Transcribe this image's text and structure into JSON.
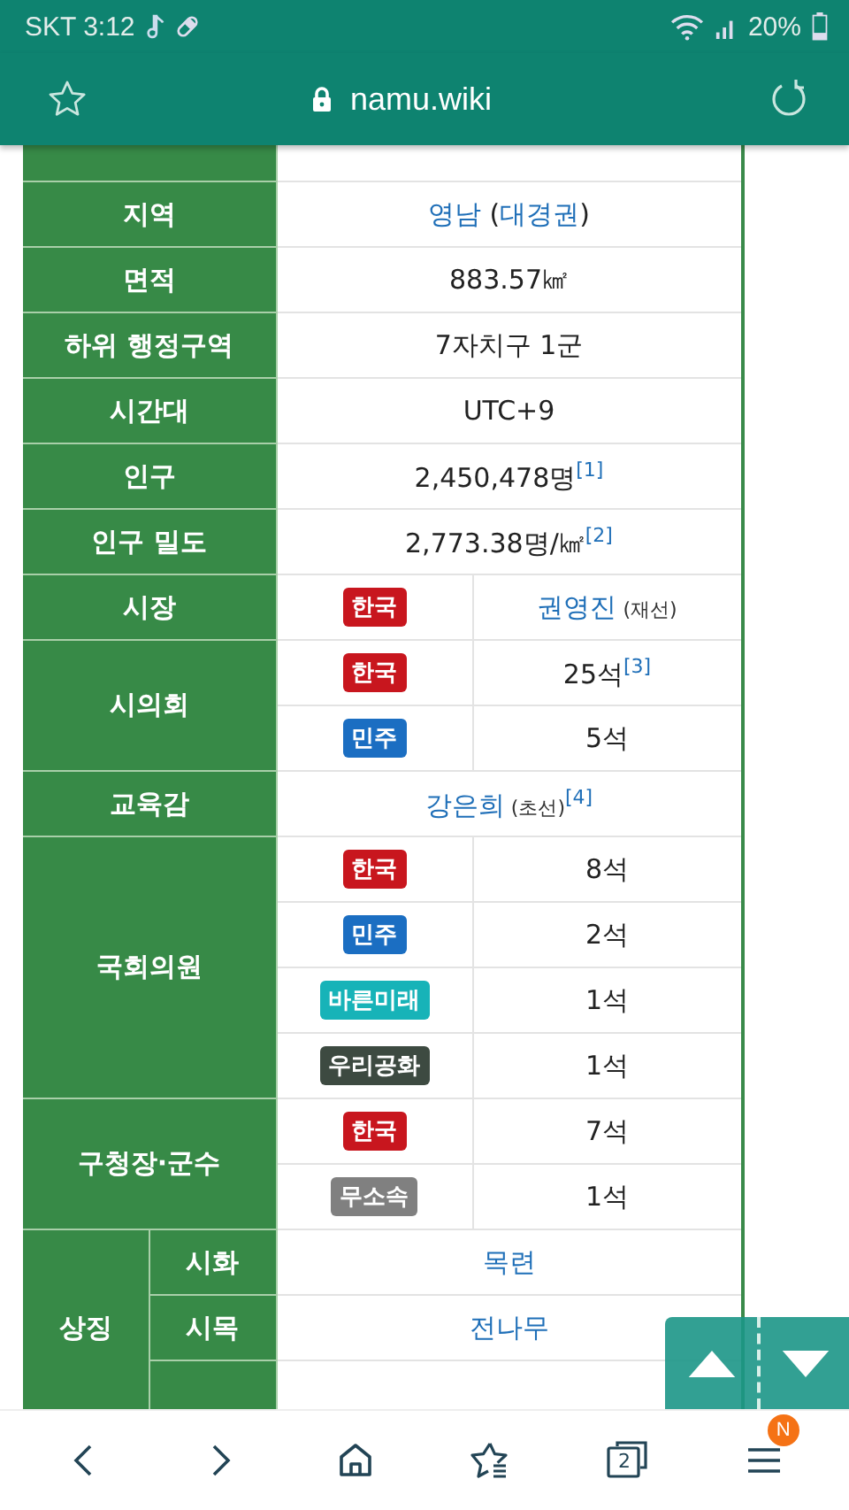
{
  "status_bar": {
    "carrier_time": "SKT 3:12",
    "battery": "20%"
  },
  "address_bar": {
    "url": "namu.wiki"
  },
  "infobox": {
    "rows": [
      {
        "kind": "single",
        "label": "지역",
        "value": [
          {
            "kind": "link",
            "text": "영남"
          },
          {
            "kind": "text",
            "text": " ("
          },
          {
            "kind": "link",
            "text": "대경권"
          },
          {
            "kind": "text",
            "text": ")"
          }
        ]
      },
      {
        "kind": "single",
        "label": "면적",
        "value": [
          {
            "kind": "text",
            "text": "883.57㎢"
          }
        ]
      },
      {
        "kind": "single",
        "label": "하위 행정구역",
        "value": [
          {
            "kind": "text",
            "text": "7자치구 1군"
          }
        ]
      },
      {
        "kind": "single",
        "label": "시간대",
        "value": [
          {
            "kind": "text",
            "text": "UTC+9"
          }
        ]
      },
      {
        "kind": "single",
        "label": "인구",
        "value": [
          {
            "kind": "text",
            "text": "2,450,478명"
          },
          {
            "kind": "note",
            "text": "[1]"
          }
        ]
      },
      {
        "kind": "single",
        "label": "인구 밀도",
        "value": [
          {
            "kind": "text",
            "text": "2,773.38명/㎢"
          },
          {
            "kind": "note",
            "text": "[2]"
          }
        ]
      },
      {
        "kind": "party",
        "label": "시장",
        "entries": [
          {
            "party": "한국",
            "color": "#c8161e",
            "value": [
              {
                "kind": "link",
                "text": "권영진"
              },
              {
                "kind": "small",
                "text": " (재선)"
              }
            ]
          }
        ]
      },
      {
        "kind": "party",
        "label": "시의회",
        "entries": [
          {
            "party": "한국",
            "color": "#c8161e",
            "value": [
              {
                "kind": "text",
                "text": "25석"
              },
              {
                "kind": "note",
                "text": "[3]"
              }
            ]
          },
          {
            "party": "민주",
            "color": "#1b6ec2",
            "value": [
              {
                "kind": "text",
                "text": "5석"
              }
            ]
          }
        ]
      },
      {
        "kind": "single",
        "label": "교육감",
        "value": [
          {
            "kind": "link",
            "text": "강은희"
          },
          {
            "kind": "small",
            "text": " (초선)"
          },
          {
            "kind": "note",
            "text": "[4]"
          }
        ]
      },
      {
        "kind": "party",
        "label": "국회의원",
        "entries": [
          {
            "party": "한국",
            "color": "#c8161e",
            "value": [
              {
                "kind": "text",
                "text": "8석"
              }
            ]
          },
          {
            "party": "민주",
            "color": "#1b6ec2",
            "value": [
              {
                "kind": "text",
                "text": "2석"
              }
            ]
          },
          {
            "party": "바른미래",
            "color": "#17b3b8",
            "value": [
              {
                "kind": "text",
                "text": "1석"
              }
            ]
          },
          {
            "party": "우리공화",
            "color": "#3d4a41",
            "value": [
              {
                "kind": "text",
                "text": "1석"
              }
            ]
          }
        ]
      },
      {
        "kind": "party",
        "label": "구청장·군수",
        "entries": [
          {
            "party": "한국",
            "color": "#c8161e",
            "value": [
              {
                "kind": "text",
                "text": "7석"
              }
            ]
          },
          {
            "party": "무소속",
            "color": "#808080",
            "value": [
              {
                "kind": "text",
                "text": "1석"
              }
            ]
          }
        ]
      },
      {
        "kind": "symbols",
        "label": "상징",
        "items": [
          {
            "label": "시화",
            "value": [
              {
                "kind": "link",
                "text": "목련"
              }
            ]
          },
          {
            "label": "시목",
            "value": [
              {
                "kind": "link",
                "text": "전나무"
              }
            ]
          }
        ]
      }
    ]
  },
  "bottom_nav": {
    "tab_count": "2",
    "menu_badge": "N"
  }
}
